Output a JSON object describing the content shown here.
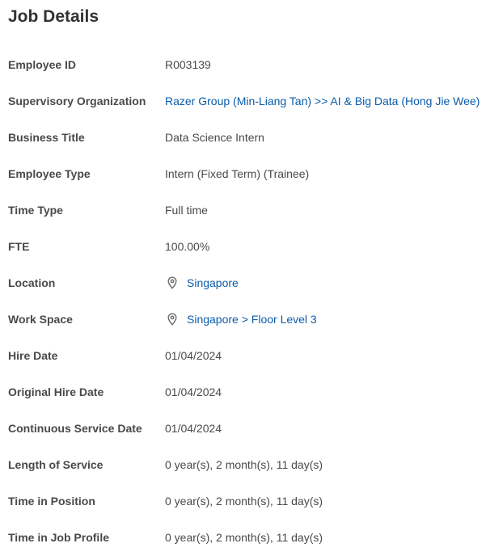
{
  "page": {
    "title": "Job Details"
  },
  "colors": {
    "text": "#494949",
    "link": "#0b5cab",
    "icon": "#6b6b6b"
  },
  "rows": [
    {
      "label": "Employee ID",
      "value": "R003139"
    },
    {
      "label": "Supervisory Organization",
      "value": "Razer Group (Min-Liang Tan) >> AI & Big Data (Hong Jie Wee)"
    },
    {
      "label": "Business Title",
      "value": "Data Science Intern"
    },
    {
      "label": "Employee Type",
      "value": "Intern (Fixed Term) (Trainee)"
    },
    {
      "label": "Time Type",
      "value": "Full time"
    },
    {
      "label": "FTE",
      "value": "100.00%"
    },
    {
      "label": "Location",
      "value": "Singapore",
      "icon": "location-pin-icon"
    },
    {
      "label": "Work Space",
      "value": "Singapore > Floor Level 3",
      "icon": "location-pin-icon"
    },
    {
      "label": "Hire Date",
      "value": "01/04/2024"
    },
    {
      "label": "Original Hire Date",
      "value": "01/04/2024"
    },
    {
      "label": "Continuous Service Date",
      "value": "01/04/2024"
    },
    {
      "label": "Length of Service",
      "value": "0 year(s), 2 month(s), 11 day(s)"
    },
    {
      "label": "Time in Position",
      "value": "0 year(s), 2 month(s), 11 day(s)"
    },
    {
      "label": "Time in Job Profile",
      "value": "0 year(s), 2 month(s), 11 day(s)"
    }
  ]
}
